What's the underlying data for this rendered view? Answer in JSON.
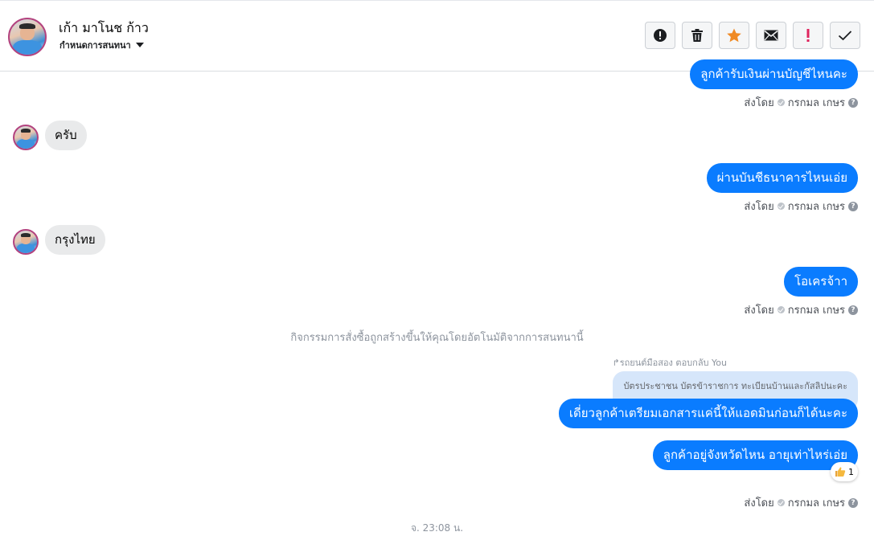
{
  "header": {
    "contact_name": "เก้า มาโนช ก้าว",
    "assign_label": "กำหนดการสนทนา",
    "toolbar": [
      {
        "name": "spam-button",
        "icon": "exclamation-circle-icon"
      },
      {
        "name": "delete-button",
        "icon": "trash-icon"
      },
      {
        "name": "star-button",
        "icon": "star-icon",
        "color": "#f08a24"
      },
      {
        "name": "mark-unread-button",
        "icon": "envelope-icon"
      },
      {
        "name": "follow-up-button",
        "icon": "exclamation-icon",
        "color": "#e0245e"
      },
      {
        "name": "mark-done-button",
        "icon": "checkmark-icon"
      }
    ]
  },
  "messages": {
    "m0_text": "ลูกค้ารับเงินผ่านบัญชีไหนคะ",
    "m1_text": "ครับ",
    "m2_text": "ผ่านบันชีธนาคารไหนเอ่ย",
    "m3_text": "กรุงไทย",
    "m4_text": "โอเครจ้าา",
    "m5_text": "เดี่ยวลูกค้าเตรียมเอกสารแค่นี้ให้แอดมินก่อนก็ได้นะคะ",
    "m6_text": "ลูกค้าอยู่จังหวัดไหน อายุเท่าไหร่เอ่ย"
  },
  "sent_by": {
    "prefix": "ส่งโดย",
    "agent": "กรกมล เกษร",
    "help": "?"
  },
  "system_note": "กิจกรรมการสั่งซื้อถูกสร้างขึ้นให้คุณโดยอัตโนมัติจากการสนทนานี้",
  "reply": {
    "label": "↱รถยนต์มือสอง ตอบกลับ You",
    "quoted_text": "บัตรประชาชน บัตรข้าราชการ ทะเบียนบ้านและกัสลิปนะคะ"
  },
  "reaction": {
    "icon": "thumbs-up-icon",
    "count": "1"
  },
  "timestamp": "จ. 23:08 น."
}
